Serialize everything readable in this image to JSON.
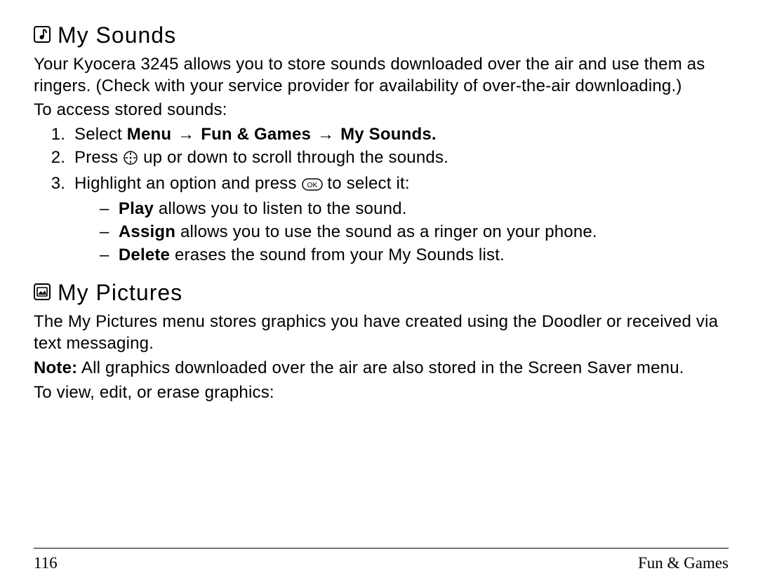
{
  "sections": {
    "sounds": {
      "heading": "My Sounds",
      "intro": "Your Kyocera 3245 allows you to store sounds downloaded over the air and use them as ringers. (Check with your service provider for availability of over-the-air downloading.)",
      "lead": "To access stored sounds:",
      "step1_prefix": "Select ",
      "step1_menu": "Menu",
      "step1_fun": "Fun & Games",
      "step1_my": "My Sounds.",
      "step2_a": "Press ",
      "step2_b": " up or down to scroll through the sounds.",
      "step3_a": "Highlight an option and press ",
      "step3_b": " to select it:",
      "opt_play_b": "Play",
      "opt_play_t": " allows you to listen to the sound.",
      "opt_assign_b": "Assign",
      "opt_assign_t": " allows you to use the sound as a ringer on your phone.",
      "opt_delete_b": "Delete",
      "opt_delete_t": " erases the sound from your My Sounds list."
    },
    "pictures": {
      "heading": "My Pictures",
      "intro": "The My Pictures menu stores graphics you have created using the Doodler or received via text messaging.",
      "note_label": "Note:",
      "note_text": " All graphics downloaded over the air are also stored in the Screen Saver menu.",
      "lead": "To view, edit, or erase graphics:"
    }
  },
  "glyphs": {
    "arrow": "→",
    "dash": "–"
  },
  "footer": {
    "page": "116",
    "section": "Fun & Games"
  }
}
